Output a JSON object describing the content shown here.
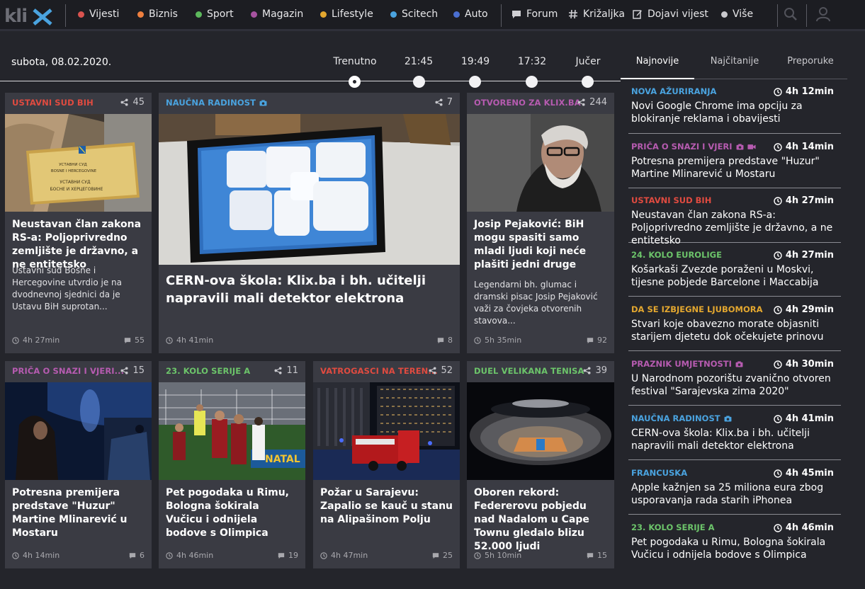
{
  "nav": {
    "logo": "klix",
    "sections": [
      {
        "label": "Vijesti",
        "color": "#d9534f"
      },
      {
        "label": "Biznis",
        "color": "#ee7f3f"
      },
      {
        "label": "Sport",
        "color": "#5cb85c"
      },
      {
        "label": "Magazin",
        "color": "#a653a0"
      },
      {
        "label": "Lifestyle",
        "color": "#e3a72f"
      },
      {
        "label": "Scitech",
        "color": "#4aa3df"
      },
      {
        "label": "Auto",
        "color": "#4a6fd1"
      }
    ],
    "links": [
      {
        "label": "Forum",
        "icon": "chat-icon"
      },
      {
        "label": "Križaljka",
        "icon": "hash-icon"
      },
      {
        "label": "Dojavi vijest",
        "icon": "edit-icon"
      },
      {
        "label": "Više",
        "icon": "dot-icon"
      }
    ]
  },
  "date": "subota, 08.02.2020.",
  "timeline": [
    "Trenutno",
    "21:45",
    "19:49",
    "17:32",
    "Jučer"
  ],
  "tabs": [
    "Najnovije",
    "Najčitanije",
    "Preporuke"
  ],
  "colors": {
    "red": "#e04b40",
    "blue": "#4aa3df",
    "purple": "#b65bb0",
    "green": "#6cc46a",
    "orange": "#e3a72f"
  },
  "cards": [
    {
      "category": "USTAVNI SUD BIH",
      "cat_color": "#e04b40",
      "shares": "45",
      "title": "Neustavan član zakona RS-a: Poljoprivredno zemljište je državno, a ne entitetsko",
      "lead": "Ustavni sud Bosne i Hercegovine utvrdio je na dvodnevnoj sjednici da je Ustavu BiH suprotan...",
      "time": "4h 27min",
      "comments": "55",
      "plaque": [
        "УСТАВНИ СУД",
        "BOSNE I HERCEGOVINE",
        "УСТАВНИ СУД",
        "БОСНЕ И ХЕРЦЕГОВИНЕ"
      ]
    },
    {
      "category": "NAUČNA RADINOST",
      "cat_color": "#4aa3df",
      "shares": "7",
      "title": "CERN-ova škola: Klix.ba i bh. učitelji napravili mali detektor elektrona",
      "lead": "",
      "time": "4h 41min",
      "comments": "8"
    },
    {
      "category": "OTVORENO ZA KLIX.BA",
      "cat_color": "#b65bb0",
      "shares": "244",
      "title": "Josip Pejaković: BiH mogu spasiti samo mladi ljudi koji neće plašiti jedni druge",
      "lead": "Legendarni bh. glumac i dramski pisac Josip Pejaković važi za čovjeka otvorenih stavova...",
      "time": "5h 35min",
      "comments": "92"
    },
    {
      "category": "PRIČA O SNAZI I VJERI...",
      "cat_color": "#b65bb0",
      "shares": "15",
      "title": "Potresna premijera predstave \"Huzur\" Martine Mlinarević u Mostaru",
      "lead": "",
      "time": "4h 14min",
      "comments": "6"
    },
    {
      "category": "23. KOLO SERIJE A",
      "cat_color": "#6cc46a",
      "shares": "11",
      "title": "Pet pogodaka u Rimu, Bologna šokirala Vučicu i odnijela bodove s Olimpica",
      "lead": "",
      "time": "4h 46min",
      "comments": "19"
    },
    {
      "category": "VATROGASCI NA TEREN...",
      "cat_color": "#e04b40",
      "shares": "52",
      "title": "Požar u Sarajevu: Zapalio se kauč u stanu na Alipašinom Polju",
      "lead": "",
      "time": "4h 47min",
      "comments": "25"
    },
    {
      "category": "DUEL VELIKANA TENISA",
      "cat_color": "#6cc46a",
      "shares": "39",
      "title": "Oboren rekord: Federerovu pobjedu nad Nadalom u Cape Townu gledalo blizu 52.000 ljudi",
      "lead": "",
      "time": "5h 10min",
      "comments": "15"
    }
  ],
  "sidebar": [
    {
      "category": "NOVA AŽURIRANJA",
      "color": "#4aa3df",
      "time": "4h 12min",
      "title": "Novi Google Chrome ima opciju za blokiranje reklama i obavijesti",
      "icons": ""
    },
    {
      "category": "PRIČA O SNAZI I VJERI",
      "color": "#b65bb0",
      "time": "4h 14min",
      "title": "Potresna premijera predstave \"Huzur\" Martine Mlinarević u Mostaru",
      "icons": "photo-video"
    },
    {
      "category": "USTAVNI SUD BIH",
      "color": "#e04b40",
      "time": "4h 27min",
      "title": "Neustavan član zakona RS-a: Poljoprivredno zemljište je državno, a ne entitetsko",
      "icons": ""
    },
    {
      "category": "24. KOLO EUROLIGE",
      "color": "#6cc46a",
      "time": "4h 27min",
      "title": "Košarkaši Zvezde poraženi u Moskvi, tijesne pobjede Barcelone i Maccabija",
      "icons": ""
    },
    {
      "category": "DA SE IZBJEGNE LJUBOMORA",
      "color": "#e3a72f",
      "time": "4h 29min",
      "title": "Stvari koje obavezno morate objasniti starijem djetetu dok očekujete prinovu",
      "icons": ""
    },
    {
      "category": "PRAZNIK UMJETNOSTI",
      "color": "#b65bb0",
      "time": "4h 30min",
      "title": "U Narodnom pozorištu zvanično otvoren festival \"Sarajevska zima 2020\"",
      "icons": "photo"
    },
    {
      "category": "NAUČNA RADINOST",
      "color": "#4aa3df",
      "time": "4h 41min",
      "title": "CERN-ova škola: Klix.ba i bh. učitelji napravili mali detektor elektrona",
      "icons": "photo"
    },
    {
      "category": "FRANCUSKA",
      "color": "#4aa3df",
      "time": "4h 45min",
      "title": "Apple kažnjen sa 25 miliona eura zbog usporavanja rada starih iPhonea",
      "icons": ""
    },
    {
      "category": "23. KOLO SERIJE A",
      "color": "#6cc46a",
      "time": "4h 46min",
      "title": "Pet pogodaka u Rimu, Bologna šokirala Vučicu i odnijela bodove s Olimpica",
      "icons": ""
    }
  ]
}
